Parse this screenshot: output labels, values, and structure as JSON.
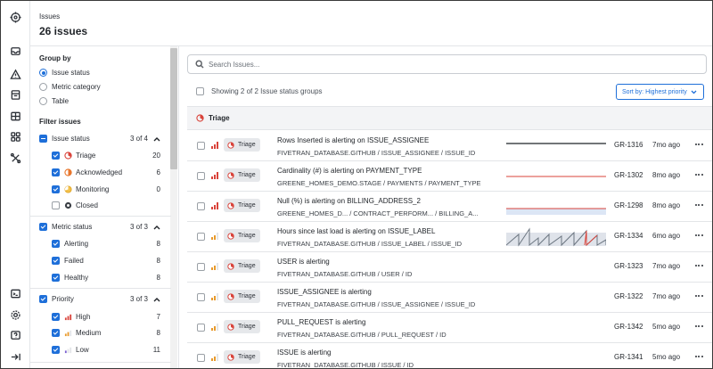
{
  "header": {
    "section": "Issues",
    "count_title": "26 issues"
  },
  "rail": {
    "top_icons": [
      "target-icon",
      "inbox-icon",
      "alert-triangle-icon",
      "database-icon",
      "grid-icon",
      "apps-icon",
      "tools-icon"
    ],
    "bottom_icons": [
      "terminal-icon",
      "gear-icon",
      "help-icon",
      "collapse-icon"
    ]
  },
  "sidebar": {
    "group_by_title": "Group by",
    "group_by_options": [
      {
        "label": "Issue status",
        "selected": true
      },
      {
        "label": "Metric category",
        "selected": false
      },
      {
        "label": "Table",
        "selected": false
      }
    ],
    "filter_title": "Filter issues",
    "groups": [
      {
        "label": "Issue status",
        "count": "3 of 4",
        "options": [
          {
            "label": "Triage",
            "count": "20",
            "checked": true,
            "icon": "triage-icon"
          },
          {
            "label": "Acknowledged",
            "count": "6",
            "checked": true,
            "icon": "acknowledged-icon"
          },
          {
            "label": "Monitoring",
            "count": "0",
            "checked": true,
            "icon": "monitoring-icon"
          },
          {
            "label": "Closed",
            "count": "",
            "checked": false,
            "icon": "closed-icon"
          }
        ]
      },
      {
        "label": "Metric status",
        "count": "3 of 3",
        "options": [
          {
            "label": "Alerting",
            "count": "8",
            "checked": true
          },
          {
            "label": "Failed",
            "count": "8",
            "checked": true
          },
          {
            "label": "Healthy",
            "count": "8",
            "checked": true
          }
        ]
      },
      {
        "label": "Priority",
        "count": "3 of 3",
        "options": [
          {
            "label": "High",
            "count": "7",
            "checked": true,
            "icon": "priority-high-icon"
          },
          {
            "label": "Medium",
            "count": "8",
            "checked": true,
            "icon": "priority-medium-icon"
          },
          {
            "label": "Low",
            "count": "11",
            "checked": true,
            "icon": "priority-low-icon"
          }
        ]
      }
    ]
  },
  "main": {
    "search_placeholder": "Search Issues...",
    "showing_text": "Showing 2 of 2 Issue status groups",
    "sort_label": "Sort by: Highest priority",
    "group_header": "Triage",
    "issues": [
      {
        "status": "Triage",
        "title": "Rows Inserted is alerting on ISSUE_ASSIGNEE",
        "path": "FIVETRAN_DATABASE.GITHUB  /  ISSUE_ASSIGNEE  /  ISSUE_ID",
        "id": "GR-1316",
        "ago": "7mo ago",
        "spark": "flat-dark"
      },
      {
        "status": "Triage",
        "title": "Cardinality (#) is alerting on PAYMENT_TYPE",
        "path": "GREENE_HOMES_DEMO.STAGE  /  PAYMENTS  /  PAYMENT_TYPE",
        "id": "GR-1302",
        "ago": "8mo ago",
        "spark": "flat-red"
      },
      {
        "status": "Triage",
        "title": "Null (%) is alerting on BILLING_ADDRESS_2",
        "path": "GREENE_HOMES_D...  /  CONTRACT_PERFORM...  /  BILLING_A...",
        "id": "GR-1298",
        "ago": "8mo ago",
        "spark": "band-red"
      },
      {
        "status": "Triage",
        "title": "Hours since last load is alerting on ISSUE_LABEL",
        "path": "FIVETRAN_DATABASE.GITHUB  /  ISSUE_LABEL  /  ISSUE_ID",
        "id": "GR-1334",
        "ago": "6mo ago",
        "spark": "sawtooth"
      },
      {
        "status": "Triage",
        "title": "USER is alerting",
        "path": "FIVETRAN_DATABASE.GITHUB  /  USER  /  ID",
        "id": "GR-1323",
        "ago": "7mo ago",
        "spark": "none"
      },
      {
        "status": "Triage",
        "title": "ISSUE_ASSIGNEE is alerting",
        "path": "FIVETRAN_DATABASE.GITHUB  /  ISSUE_ASSIGNEE  /  ISSUE_ID",
        "id": "GR-1322",
        "ago": "7mo ago",
        "spark": "none"
      },
      {
        "status": "Triage",
        "title": "PULL_REQUEST is alerting",
        "path": "FIVETRAN_DATABASE.GITHUB  /  PULL_REQUEST  /  ID",
        "id": "GR-1342",
        "ago": "5mo ago",
        "spark": "none"
      },
      {
        "status": "Triage",
        "title": "ISSUE is alerting",
        "path": "FIVETRAN_DATABASE.GITHUB  /  ISSUE  /  ID",
        "id": "GR-1341",
        "ago": "5mo ago",
        "spark": "none"
      }
    ]
  },
  "colors": {
    "accent": "#1e6fd9",
    "alert_red": "#d9433a",
    "priority_high": "#d9433a",
    "priority_medium": "#e89a2c",
    "priority_low": "#7a5fd1"
  }
}
